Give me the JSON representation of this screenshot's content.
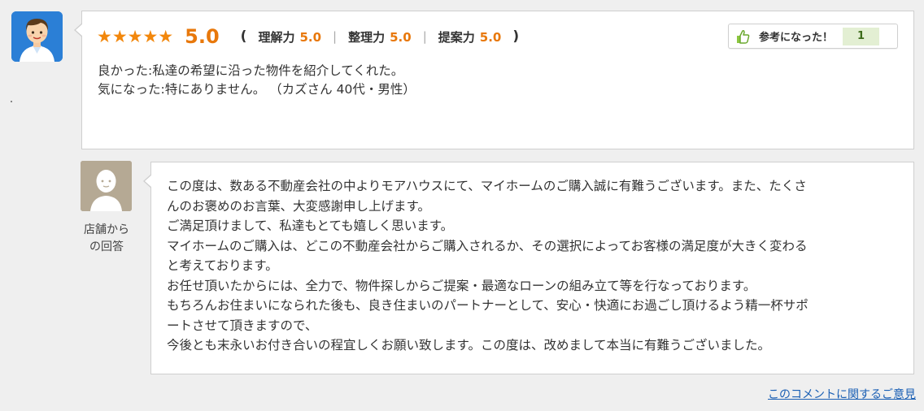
{
  "review": {
    "stars": "★★★★★",
    "score": "5.0",
    "open_paren": "(",
    "close_paren": ")",
    "sub_ratings": [
      {
        "label": "理解力",
        "value": "5.0"
      },
      {
        "label": "整理力",
        "value": "5.0"
      },
      {
        "label": "提案力",
        "value": "5.0"
      }
    ],
    "separator": "|",
    "helpful": {
      "label": "参考になった！",
      "count": "1"
    },
    "lines": [
      "良かった:私達の希望に沿った物件を紹介してくれた。",
      "気になった:特にありません。 （カズさん 40代・男性）"
    ]
  },
  "shop": {
    "label_line1": "店舗から",
    "label_line2": "の回答"
  },
  "reply": {
    "lines": [
      "この度は、数ある不動産会社の中よりモアハウスにて、マイホームのご購入誠に有難うございます。また、たくさ",
      "んのお褒めのお言葉、大変感謝申し上げます。",
      "ご満足頂けまして、私達もとても嬉しく思います。",
      "マイホームのご購入は、どこの不動産会社からご購入されるか、その選択によってお客様の満足度が大きく変わる",
      "と考えております。",
      "お任せ頂いたからには、全力で、物件探しからご提案・最適なローンの組み立て等を行なっております。",
      "もちろんお住まいになられた後も、良き住まいのパートナーとして、安心・快適にお過ごし頂けるよう精一杯サポ",
      "ートさせて頂きますので、",
      "今後とも末永いお付き合いの程宜しくお願い致します。この度は、改めまして本当に有難うございました。"
    ]
  },
  "footer": {
    "feedback_link": "このコメントに関するご意見"
  },
  "colors": {
    "accent_orange": "#e8780b",
    "link_blue": "#1a5fb4",
    "helpful_green_bg": "#e3efd3"
  },
  "icons": {
    "user_avatar": "male-user-avatar-icon",
    "shop_avatar": "generic-person-avatar-icon",
    "helpful": "thumbs-up-icon"
  }
}
